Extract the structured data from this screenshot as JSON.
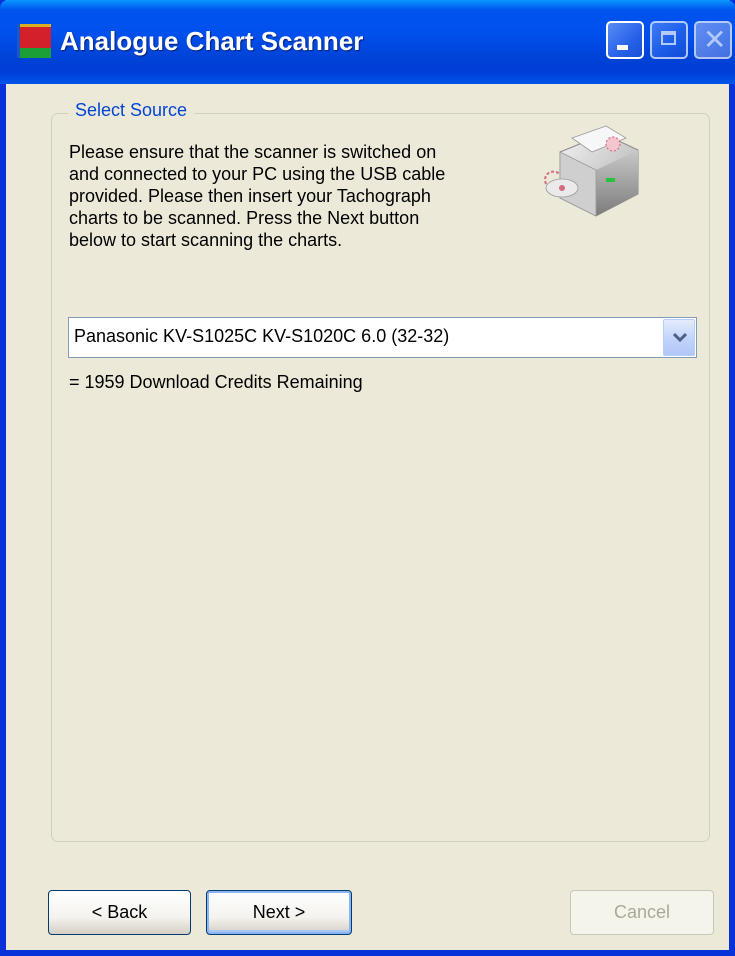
{
  "window": {
    "title": "Analogue Chart Scanner",
    "icon": "app-chart-icon"
  },
  "group": {
    "legend": "Select Source",
    "instructions": [
      "Please ensure that the scanner is switched on",
      "and connected to your PC using the USB cable",
      "provided.  Please then insert your Tachograph",
      "charts to be scanned.  Press the Next button",
      "below to start scanning the charts."
    ],
    "image_icon": "scanner-icon"
  },
  "source_select": {
    "selected": "Panasonic KV-S1025C KV-S1020C 6.0 (32-32)"
  },
  "credits_text": "= 1959 Download Credits Remaining",
  "buttons": {
    "back": "< Back",
    "next": "Next >",
    "cancel": "Cancel"
  },
  "colors": {
    "title_bar": "#0053ee",
    "legend_text": "#0046d5",
    "window_bg": "#ece9d8"
  }
}
